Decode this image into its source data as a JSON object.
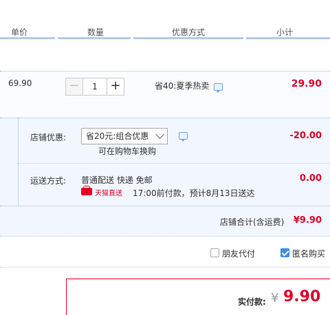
{
  "header": {
    "col_unit_price": "单价",
    "col_quantity": "数量",
    "col_discount": "优惠方式",
    "col_subtotal": "小计"
  },
  "item": {
    "unit_price": "69.90",
    "quantity": "1",
    "minus": "−",
    "plus": "+",
    "promo": "省40:夏季热卖",
    "subtotal": "29.90"
  },
  "shop": {
    "discount_label": "店铺优惠:",
    "discount_select": "省20元:组合优惠",
    "discount_hint": "可在购物车换购",
    "discount_amount": "-20.00",
    "shipping_label": "运送方式:",
    "shipping_method": "普通配送 快递 免邮",
    "tmall_badge": "天猫直送",
    "delivery_note": "17:00前付款，预计8月13日送达",
    "shipping_amount": "0.00",
    "total_label": "店铺合计(含运费)",
    "total_amount": "¥9.90"
  },
  "options": {
    "friend_pay": "朋友代付",
    "friend_pay_checked": false,
    "anonymous": "匿名购买",
    "anonymous_checked": true
  },
  "payment": {
    "label": "实付款:",
    "currency": "¥",
    "amount": "9.90"
  },
  "colors": {
    "accent_red": "#e4002b",
    "header_line": "#b5cbe8",
    "checkbox_blue": "#3b8df0"
  }
}
